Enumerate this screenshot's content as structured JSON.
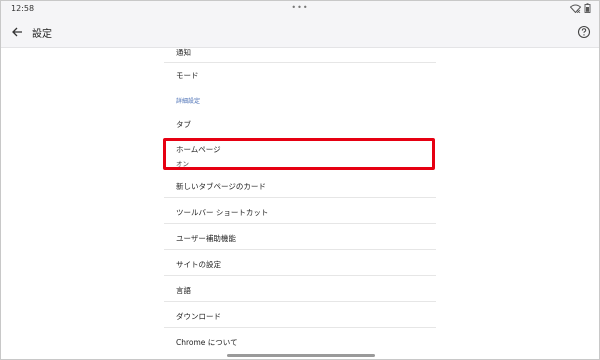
{
  "status_bar": {
    "time": "12:58",
    "center_dots": "•••",
    "icons": [
      "wifi-icon",
      "battery-icon"
    ]
  },
  "app_bar": {
    "title": "設定",
    "back_icon": "arrow-left-icon",
    "help_icon": "help-circle-icon"
  },
  "settings": {
    "items": [
      {
        "label": "通知"
      },
      {
        "label": "モード"
      },
      {
        "label": "タブ"
      },
      {
        "label": "ホームページ",
        "sub": "オン"
      },
      {
        "label": "新しいタブページのカード"
      },
      {
        "label": "ツールバー ショートカット"
      },
      {
        "label": "ユーザー補助機能"
      },
      {
        "label": "サイトの設定"
      },
      {
        "label": "言語"
      },
      {
        "label": "ダウンロード"
      },
      {
        "label": "Chrome について"
      }
    ],
    "section_header": "詳細設定"
  },
  "highlight_color": "#e60012"
}
